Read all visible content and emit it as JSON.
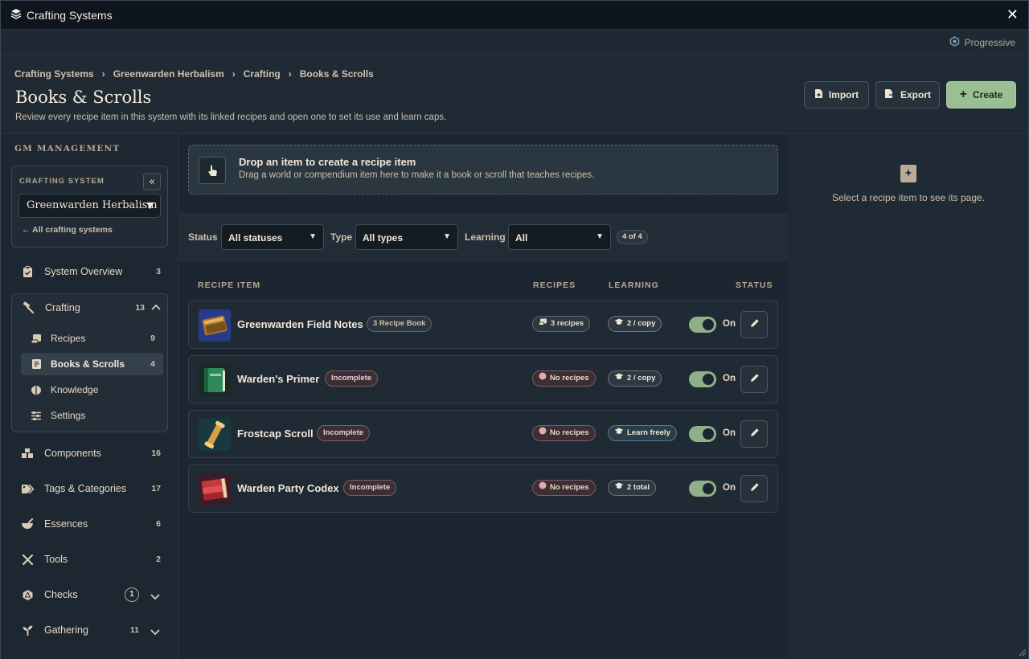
{
  "window": {
    "title": "Crafting Systems",
    "mode": "Progressive"
  },
  "breadcrumb": [
    "Crafting Systems",
    "Greenwarden Herbalism",
    "Crafting",
    "Books & Scrolls"
  ],
  "page": {
    "title": "Books & Scrolls",
    "description": "Review every recipe item in this system with its linked recipes and open one to set its use and learn caps."
  },
  "actions": {
    "import": "Import",
    "export": "Export",
    "create": "Create"
  },
  "sidebar": {
    "section_label": "GM MANAGEMENT",
    "crafting_system_label": "CRAFTING SYSTEM",
    "selected_system": "Greenwarden Herbalism",
    "back_link": "All crafting systems",
    "overview": {
      "label": "System Overview",
      "count": "3"
    },
    "crafting": {
      "label": "Crafting",
      "count": "13",
      "children": [
        {
          "label": "Recipes",
          "count": "9"
        },
        {
          "label": "Books & Scrolls",
          "count": "4"
        },
        {
          "label": "Knowledge",
          "count": ""
        },
        {
          "label": "Settings",
          "count": ""
        }
      ]
    },
    "items": [
      {
        "label": "Components",
        "count": "16"
      },
      {
        "label": "Tags & Categories",
        "count": "17"
      },
      {
        "label": "Essences",
        "count": "6"
      },
      {
        "label": "Tools",
        "count": "2"
      },
      {
        "label": "Checks",
        "count": "1"
      },
      {
        "label": "Gathering",
        "count": "11"
      }
    ]
  },
  "dropzone": {
    "title": "Drop an item to create a recipe item",
    "subtitle": "Drag a world or compendium item here to make it a book or scroll that teaches recipes."
  },
  "filters": {
    "status_label": "Status",
    "status_value": "All statuses",
    "type_label": "Type",
    "type_value": "All types",
    "learning_label": "Learning",
    "learning_value": "All",
    "count": "4 of 4"
  },
  "table": {
    "headers": {
      "item": "RECIPE ITEM",
      "recipes": "RECIPES",
      "learning": "LEARNING",
      "status": "STATUS"
    },
    "rows": [
      {
        "name": "Greenwarden Field Notes",
        "tag": "3 Recipe Book",
        "tag_kind": "tag",
        "recipes": "3 recipes",
        "recipes_none": false,
        "learning": "2 / copy",
        "learning_free": false,
        "status": "On",
        "thumb": "brown"
      },
      {
        "name": "Warden's Primer",
        "tag": "Incomplete",
        "tag_kind": "warn",
        "recipes": "No recipes",
        "recipes_none": true,
        "learning": "2 / copy",
        "learning_free": false,
        "status": "On",
        "thumb": "green"
      },
      {
        "name": "Frostcap Scroll",
        "tag": "Incomplete",
        "tag_kind": "warn",
        "recipes": "No recipes",
        "recipes_none": true,
        "learning": "Learn freely",
        "learning_free": true,
        "status": "On",
        "thumb": "scroll"
      },
      {
        "name": "Warden Party Codex",
        "tag": "Incomplete",
        "tag_kind": "warn",
        "recipes": "No recipes",
        "recipes_none": true,
        "learning": "2 total",
        "learning_free": false,
        "status": "On",
        "thumb": "red"
      }
    ]
  },
  "detail_panel": {
    "empty_text": "Select a recipe item to see its page."
  },
  "colors": {
    "accent_green": "#9bbf93",
    "toggle_on": "#8fb088",
    "warn_border": "#7b5f66",
    "panel_bg": "#1f2a35"
  }
}
